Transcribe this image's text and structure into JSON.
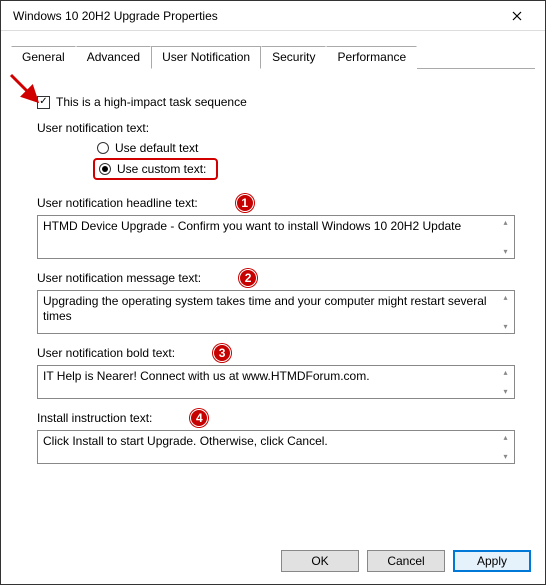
{
  "window": {
    "title": "Windows 10 20H2 Upgrade Properties"
  },
  "tabs": {
    "general": "General",
    "advanced": "Advanced",
    "user_notification": "User Notification",
    "security": "Security",
    "performance": "Performance"
  },
  "checkbox": {
    "high_impact": "This is a high-impact task sequence"
  },
  "group": {
    "heading": "User notification text:"
  },
  "radio": {
    "default_text": "Use default text",
    "custom_text": "Use custom text:"
  },
  "sections": {
    "headline": {
      "label": "User notification headline text:",
      "badge": "1",
      "value": "HTMD Device Upgrade - Confirm you want to install Windows 10 20H2 Update"
    },
    "message": {
      "label": "User notification message text:",
      "badge": "2",
      "value": "Upgrading the operating system takes time and your computer might restart several times"
    },
    "bold": {
      "label": "User notification bold text:",
      "badge": "3",
      "value": "IT Help is Nearer! Connect with us at www.HTMDForum.com."
    },
    "install": {
      "label": "Install instruction text:",
      "badge": "4",
      "value": "Click Install to start Upgrade. Otherwise, click Cancel."
    }
  },
  "buttons": {
    "ok": "OK",
    "cancel": "Cancel",
    "apply": "Apply"
  }
}
